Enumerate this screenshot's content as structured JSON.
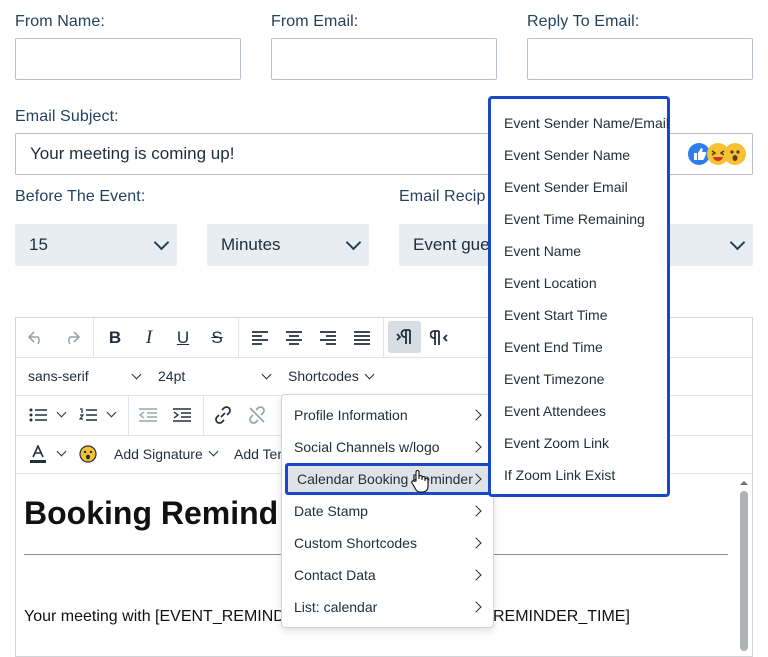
{
  "form": {
    "from_name_label": "From Name:",
    "from_email_label": "From Email:",
    "reply_to_label": "Reply To Email:",
    "subject_label": "Email Subject:",
    "subject_value": "Your meeting is coming up!",
    "before_event_label": "Before The Event:",
    "before_value": "15",
    "unit_value": "Minutes",
    "recipients_label": "Email Recip",
    "recipients_value": "Event gue"
  },
  "toolbar": {
    "font_family": "sans-serif",
    "font_size": "24pt",
    "shortcodes": "Shortcodes",
    "add_signature": "Add Signature",
    "add_template": "Add Ter",
    "bold": "B",
    "italic": "I",
    "underline": "U",
    "strike": "S"
  },
  "content": {
    "heading": "Booking Remind",
    "paragraph_left": "Your meeting with [EVENT_REMIND",
    "paragraph_right": "REMINDER_TIME]"
  },
  "shortcodes_menu": [
    {
      "label": "Profile Information"
    },
    {
      "label": "Social Channels w/logo"
    },
    {
      "label": "Calendar Booking Reminder"
    },
    {
      "label": "Date Stamp"
    },
    {
      "label": "Custom Shortcodes"
    },
    {
      "label": "Contact Data"
    },
    {
      "label": "List: calendar"
    }
  ],
  "submenu": [
    "Event Sender Name/Email",
    "Event Sender Name",
    "Event Sender Email",
    "Event Time Remaining",
    "Event Name",
    "Event Location",
    "Event Start Time",
    "Event End Time",
    "Event Timezone",
    "Event Attendees",
    "Event Zoom Link",
    "If Zoom Link Exist"
  ],
  "colors": {
    "highlight": "#1749c9",
    "field_bg": "#e8edf1",
    "label": "#23425f"
  }
}
